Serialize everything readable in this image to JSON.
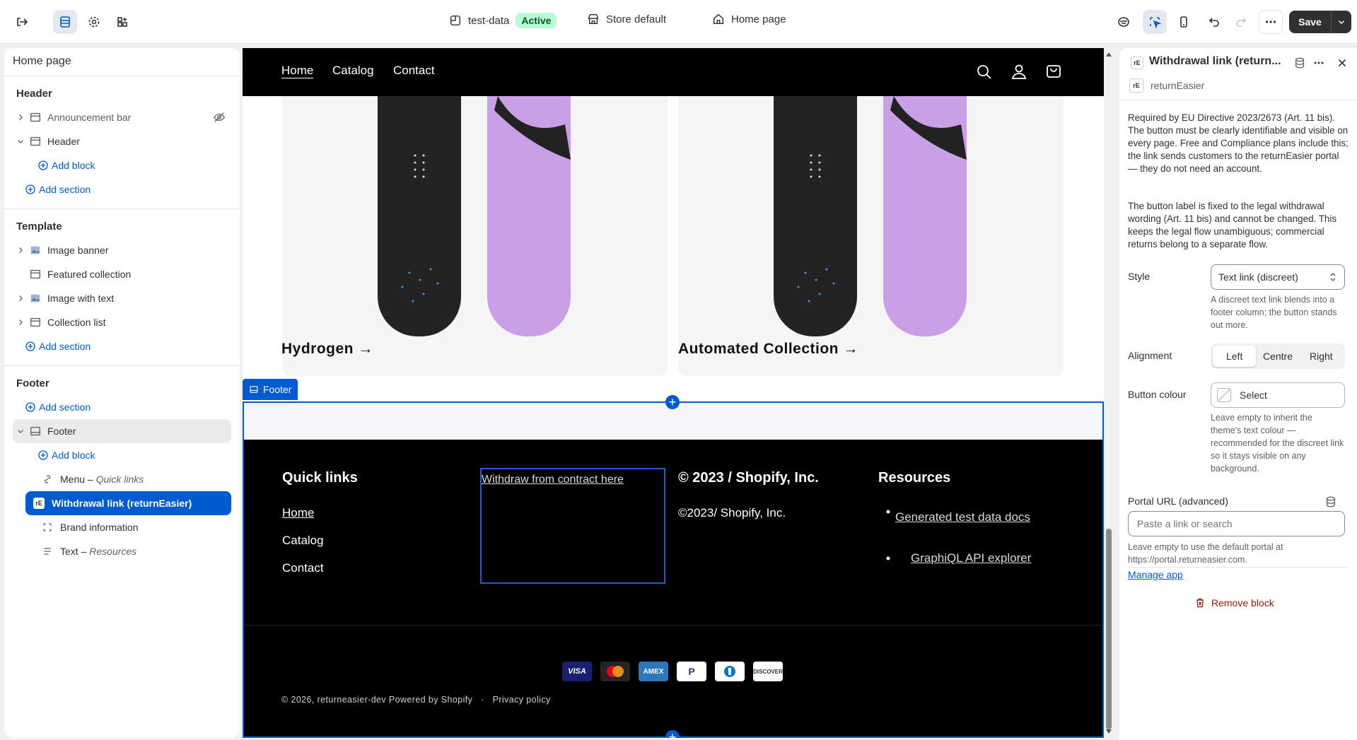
{
  "topbar": {
    "theme_name": "test-data",
    "theme_status": "Active",
    "store": "Store default",
    "page": "Home page",
    "save_label": "Save"
  },
  "left_panel": {
    "title": "Home page",
    "header_group": {
      "title": "Header",
      "items": [
        {
          "label": "Announcement bar"
        },
        {
          "label": "Header"
        }
      ],
      "add_block": "Add block",
      "add_section": "Add section"
    },
    "template_group": {
      "title": "Template",
      "items": [
        {
          "label": "Image banner"
        },
        {
          "label": "Featured collection"
        },
        {
          "label": "Image with text"
        },
        {
          "label": "Collection list"
        }
      ],
      "add_section": "Add section"
    },
    "footer_group": {
      "title": "Footer",
      "add_section": "Add section",
      "footer_label": "Footer",
      "add_block": "Add block",
      "menu_label": "Menu",
      "menu_sub": "Quick links",
      "selected": "Withdrawal link (returnEasier)",
      "brand": "Brand information",
      "text_label": "Text",
      "text_sub": "Resources"
    }
  },
  "preview": {
    "nav": [
      "Home",
      "Catalog",
      "Contact"
    ],
    "products": [
      "Hydrogen →",
      "Automated Collection →"
    ],
    "footer_label": "Footer",
    "footer": {
      "quick_links_title": "Quick links",
      "quick_links": [
        "Home",
        "Catalog",
        "Contact"
      ],
      "withdraw_link": "Withdraw from contract here",
      "copyright_title": "© 2023 / Shopify, Inc.",
      "copyright_text": "©2023/ Shopify, Inc.",
      "resources_title": "Resources",
      "resources": [
        "Generated test data docs",
        "GraphiQL API explorer"
      ],
      "payment_icons": [
        "VISA",
        "Mastercard",
        "AMEX",
        "PayPal",
        "Diners",
        "DISCOVER"
      ],
      "bottom_copy": "© 2026, returneasier-dev Powered by Shopify",
      "bottom_sep": "·",
      "privacy": "Privacy policy"
    }
  },
  "right_panel": {
    "title": "Withdrawal link (return...",
    "app_name": "returnEasier",
    "desc1": "Required by EU Directive 2023/2673 (Art. 11 bis). The button must be clearly identifiable and visible on every page. Free and Compliance plans include this; the link sends customers to the returnEasier portal — they do not need an account.",
    "desc2": "The button label is fixed to the legal withdrawal wording (Art. 11 bis) and cannot be changed. This keeps the legal flow unambiguous; commercial returns belong to a separate flow.",
    "style_label": "Style",
    "style_value": "Text link (discreet)",
    "style_hint": "A discreet text link blends into a footer column; the button stands out more.",
    "alignment_label": "Alignment",
    "alignment_options": [
      "Left",
      "Centre",
      "Right"
    ],
    "button_colour_label": "Button colour",
    "button_colour_value": "Select",
    "button_colour_hint": "Leave empty to inherit the theme's text colour — recommended for the discreet link so it stays visible on any background.",
    "portal_label": "Portal URL (advanced)",
    "portal_placeholder": "Paste a link or search",
    "portal_hint": "Leave empty to use the default portal at https://portal.returneasier.com.",
    "manage_app": "Manage app",
    "remove_block": "Remove block"
  },
  "colors": {
    "accent": "#005bd3",
    "danger": "#8e1f0b",
    "active_badge": "#b4fed2"
  }
}
